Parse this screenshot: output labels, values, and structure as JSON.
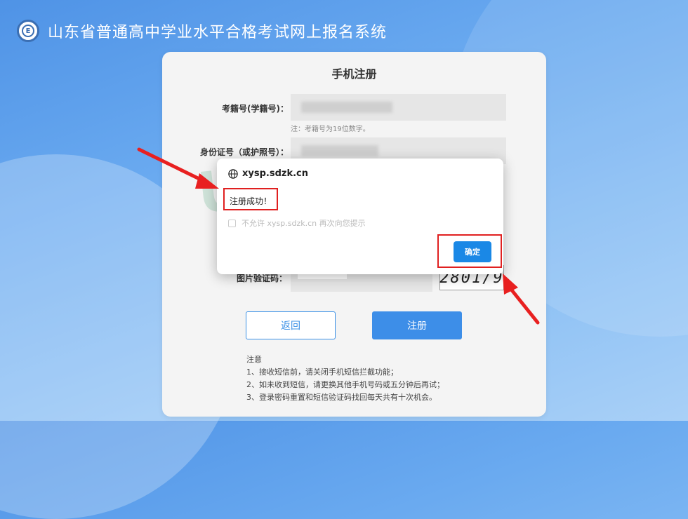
{
  "header": {
    "title": "山东省普通高中学业水平合格考试网上报名系统",
    "logo_letter": "E"
  },
  "form": {
    "title": "手机注册",
    "exam_no_label": "考籍号(学籍号)：",
    "exam_no_hint": "注：考籍号为19位数字。",
    "id_label": "身份证号（或护照号）：",
    "captcha_label": "图片验证码：",
    "captcha_text": "2801/9",
    "back_button": "返回",
    "register_button": "注册"
  },
  "notes": {
    "heading": "注意",
    "items": [
      "1、接收短信前，请关闭手机短信拦截功能；",
      "2、如未收到短信，请更换其他手机号码或五分钟后再试；",
      "3、登录密码重置和短信验证码找回每天共有十次机会。"
    ]
  },
  "dialog": {
    "origin": "xysp.sdzk.cn",
    "message": "注册成功！",
    "suppress_label": "不允许 xysp.sdzk.cn 再次向您提示",
    "ok_button": "确定",
    "highlight_color": "#e02020",
    "button_color": "#1a88e6"
  },
  "annotations": {
    "arrow_color": "#e82020"
  }
}
